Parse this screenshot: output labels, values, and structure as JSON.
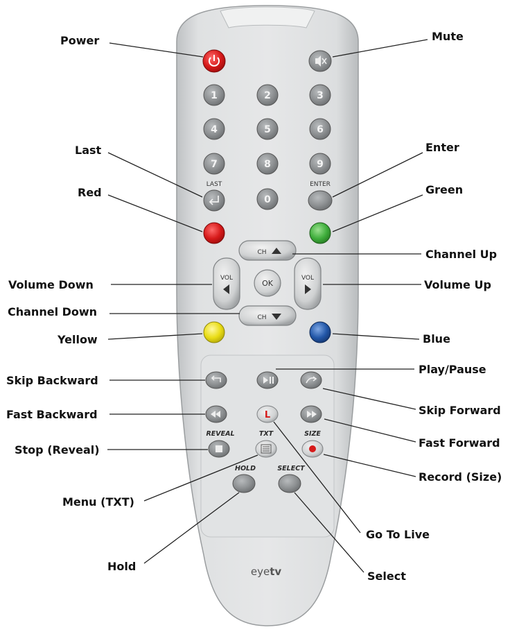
{
  "remote": {
    "brand_light": "eye",
    "brand_bold": "tv",
    "digits": [
      "1",
      "2",
      "3",
      "4",
      "5",
      "6",
      "7",
      "8",
      "9",
      "0"
    ],
    "button_labels": {
      "last": "LAST",
      "enter": "ENTER",
      "ch": "CH",
      "vol": "VOL",
      "ok": "OK",
      "reveal": "REVEAL",
      "txt": "TXT",
      "size": "SIZE",
      "hold": "HOLD",
      "select": "SELECT",
      "go_to_live": "L"
    },
    "colors": {
      "body": "#d9dbdc",
      "button_gray": "#8b8e90",
      "power_red": "#d2201f",
      "red": "#d61a1a",
      "green": "#3fae3c",
      "yellow": "#e9dc14",
      "blue": "#2257a8"
    }
  },
  "callouts": {
    "power": "Power",
    "mute": "Mute",
    "last": "Last",
    "enter": "Enter",
    "red": "Red",
    "green": "Green",
    "channel_up": "Channel Up",
    "volume_down": "Volume Down",
    "volume_up": "Volume Up",
    "channel_down": "Channel Down",
    "yellow": "Yellow",
    "blue": "Blue",
    "play_pause": "Play/Pause",
    "skip_backward": "Skip Backward",
    "skip_forward": "Skip Forward",
    "fast_backward": "Fast Backward",
    "fast_forward": "Fast Forward",
    "stop_reveal": "Stop (Reveal)",
    "record_size": "Record (Size)",
    "menu_txt": "Menu (TXT)",
    "go_to_live": "Go To Live",
    "hold": "Hold",
    "select": "Select"
  }
}
